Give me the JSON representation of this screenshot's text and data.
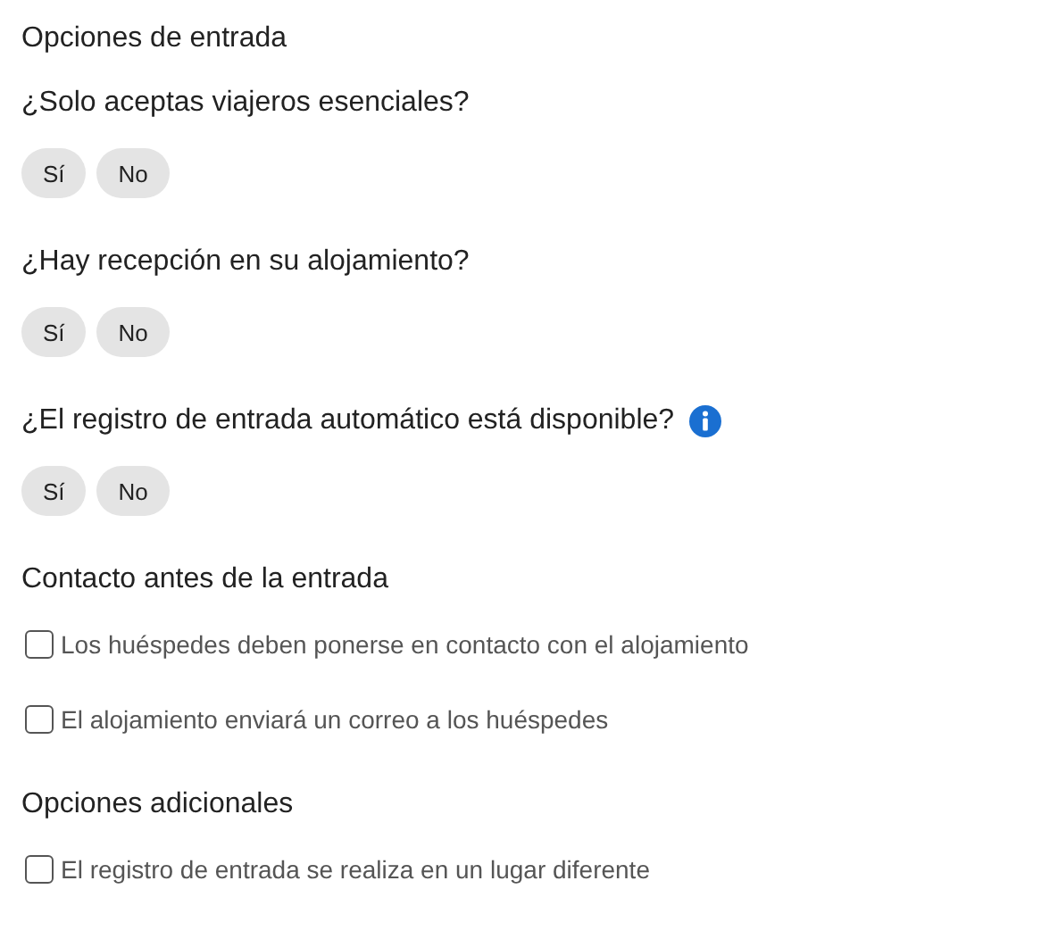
{
  "sections": [
    {
      "title": "Opciones de entrada",
      "items": [
        {
          "kind": "question",
          "label": "¿Solo aceptas viajeros esenciales?",
          "info": false,
          "options": [
            {
              "label": "Sí",
              "selected": false
            },
            {
              "label": "No",
              "selected": false
            }
          ]
        },
        {
          "kind": "question",
          "label": "¿Hay recepción en su alojamiento?",
          "info": false,
          "options": [
            {
              "label": "Sí",
              "selected": false
            },
            {
              "label": "No",
              "selected": false
            }
          ]
        },
        {
          "kind": "question",
          "label": "¿El registro de entrada automático está disponible?",
          "info": true,
          "options": [
            {
              "label": "Sí",
              "selected": false
            },
            {
              "label": "No",
              "selected": false
            }
          ]
        }
      ]
    },
    {
      "title": "Contacto antes de la entrada",
      "items": [
        {
          "kind": "checkbox",
          "label": "Los huéspedes deben ponerse en contacto con el alojamiento",
          "checked": false
        },
        {
          "kind": "checkbox",
          "label": "El alojamiento enviará un correo a los huéspedes",
          "checked": false
        }
      ]
    },
    {
      "title": "Opciones adicionales",
      "items": [
        {
          "kind": "checkbox",
          "label": "El registro de entrada se realiza en un lugar diferente",
          "checked": false
        }
      ]
    }
  ]
}
